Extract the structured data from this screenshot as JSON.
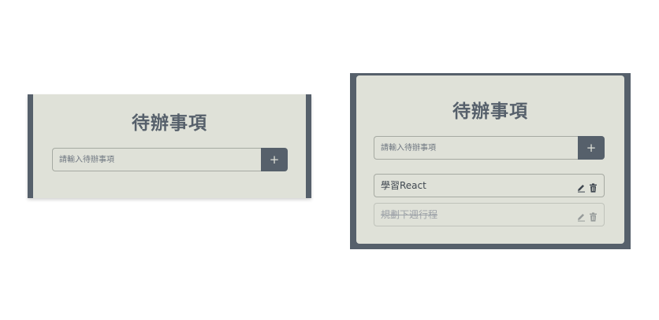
{
  "left_panel": {
    "title": "待辦事項",
    "input": {
      "placeholder": "請輸入待辦事項",
      "value": ""
    },
    "add_button_label": "+"
  },
  "right_panel": {
    "title": "待辦事項",
    "input": {
      "placeholder": "請輸入待辦事項",
      "value": ""
    },
    "add_button_label": "+",
    "items": [
      {
        "text": "學習React",
        "completed": false,
        "edit_icon": "pencil-icon",
        "delete_icon": "trash-icon"
      },
      {
        "text": "規劃下週行程",
        "completed": true,
        "edit_icon": "pencil-icon",
        "delete_icon": "trash-icon"
      }
    ]
  },
  "colors": {
    "frame": "#56606b",
    "panel_bg": "#dfe1d8",
    "border": "#a6aaa2",
    "text": "#3f4750",
    "done_text": "#9da2a8"
  }
}
